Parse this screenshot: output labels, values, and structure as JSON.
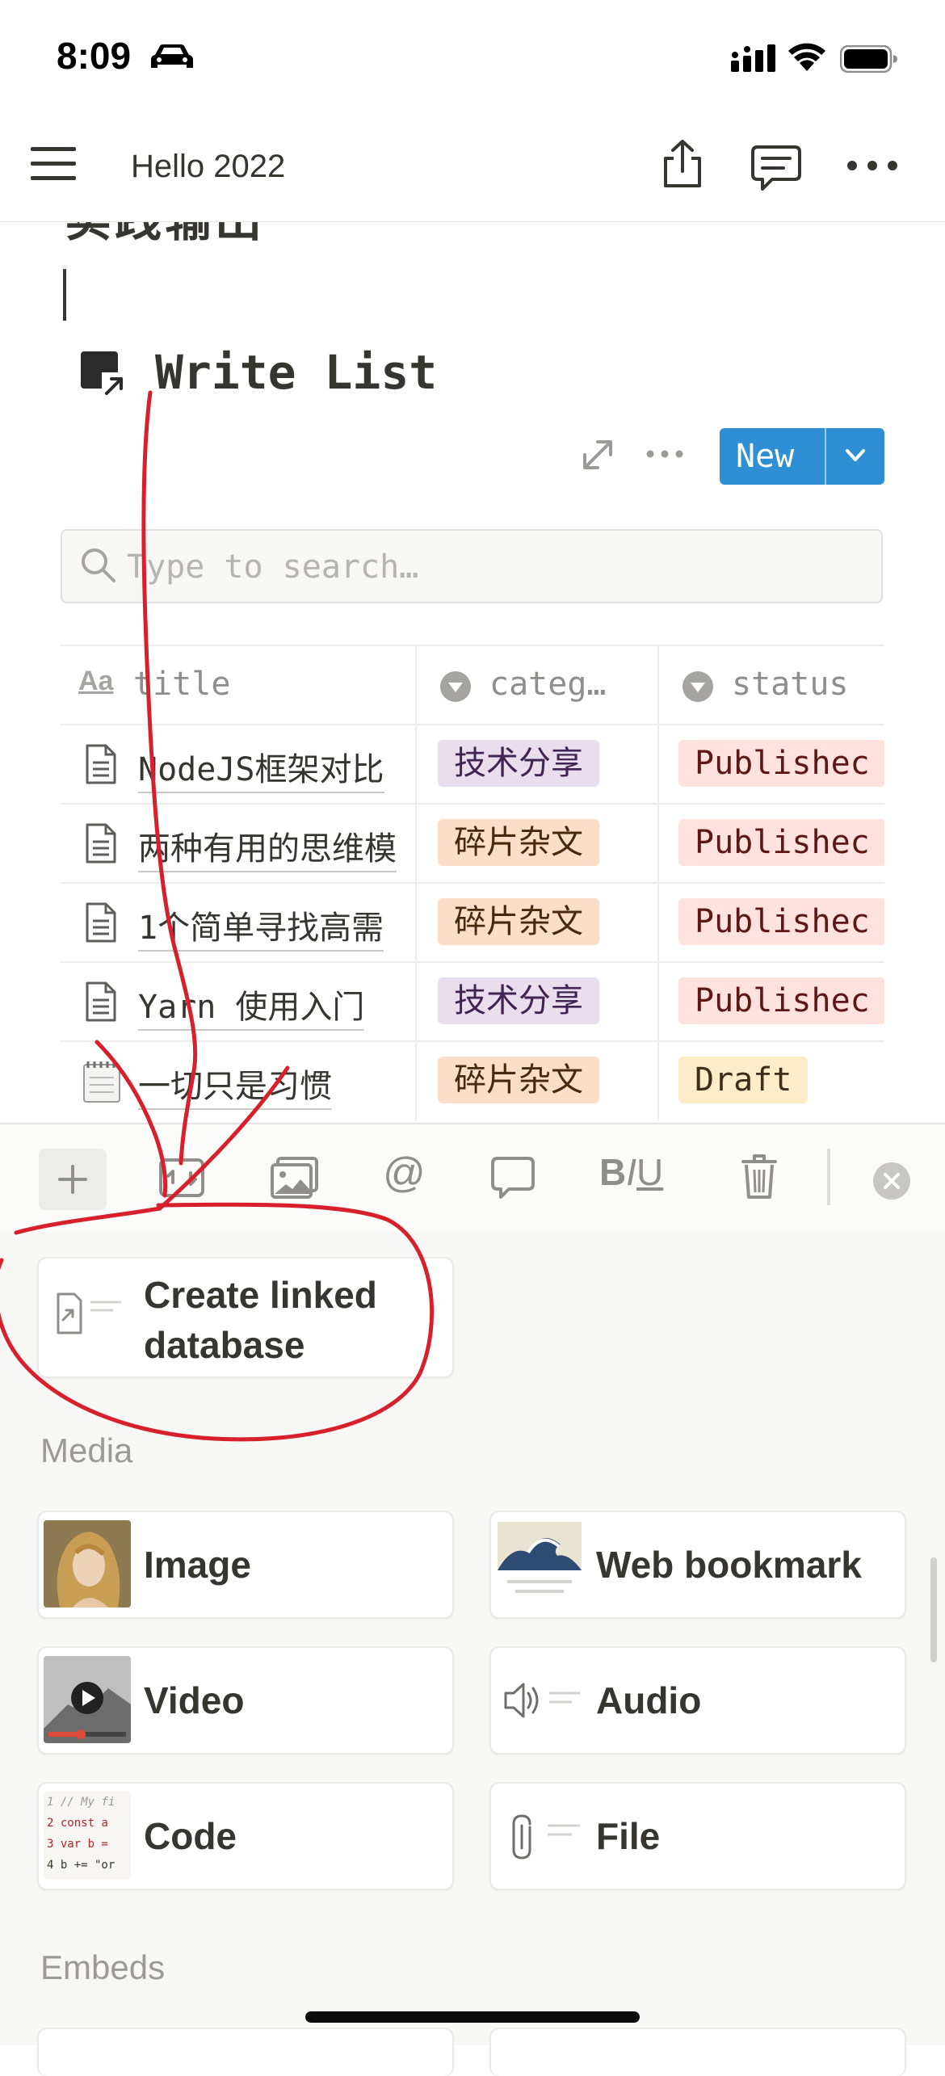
{
  "status_bar": {
    "time": "8:09"
  },
  "nav": {
    "title": "Hello 2022"
  },
  "content": {
    "heading_partial": "实践输出",
    "database": {
      "title": "Write List",
      "new_label": "New",
      "search_placeholder": "Type to search…",
      "columns": [
        "title",
        "categ…",
        "status"
      ],
      "rows": [
        {
          "title": "NodeJS框架对比",
          "category": "技术分享",
          "category_color": "purple",
          "status": "Publishec",
          "status_color": "red"
        },
        {
          "title": "两种有用的思维模",
          "category": "碎片杂文",
          "category_color": "orange",
          "status": "Publishec",
          "status_color": "red"
        },
        {
          "title": "1个简单寻找高需",
          "category": "碎片杂文",
          "category_color": "orange",
          "status": "Publishec",
          "status_color": "red"
        },
        {
          "title": "Yarn 使用入门",
          "category": "技术分享",
          "category_color": "purple",
          "status": "Publishec",
          "status_color": "red"
        },
        {
          "title": "一切只是习惯",
          "category": "碎片杂文",
          "category_color": "orange",
          "status": "Draft",
          "status_color": "yellow"
        }
      ]
    }
  },
  "toolbar": {
    "icons": [
      "plus-icon",
      "turn-into-icon",
      "image-icon",
      "mention-icon",
      "comment-icon",
      "text-format-icon",
      "trash-icon",
      "close-icon"
    ],
    "format_label_b": "B",
    "format_label_i": "I",
    "format_label_u": "U"
  },
  "picker": {
    "linked_database_label": "Create linked database",
    "linked_database_line1": "Create linked",
    "linked_database_line2": "database",
    "media_section": "Media",
    "media_items": [
      {
        "label": "Image",
        "icon": "image-thumbnail"
      },
      {
        "label": "Web bookmark",
        "icon": "bookmark-thumbnail"
      },
      {
        "label": "Video",
        "icon": "video-thumbnail"
      },
      {
        "label": "Audio",
        "icon": "speaker-icon"
      },
      {
        "label": "Code",
        "icon": "code-thumbnail"
      },
      {
        "label": "File",
        "icon": "paperclip-icon"
      }
    ],
    "embeds_section": "Embeds",
    "code_thumb_lines": [
      "1 // My fi",
      "2 const a",
      "3 var b =",
      "4 b += \"or"
    ]
  },
  "colors": {
    "new_button": "#2f8fd5",
    "annotation_stroke": "#d8202c",
    "tag_purple": "#e8deee",
    "tag_orange": "#fadec9",
    "tag_red": "#ffe2dd",
    "tag_yellow": "#fdecc8"
  }
}
